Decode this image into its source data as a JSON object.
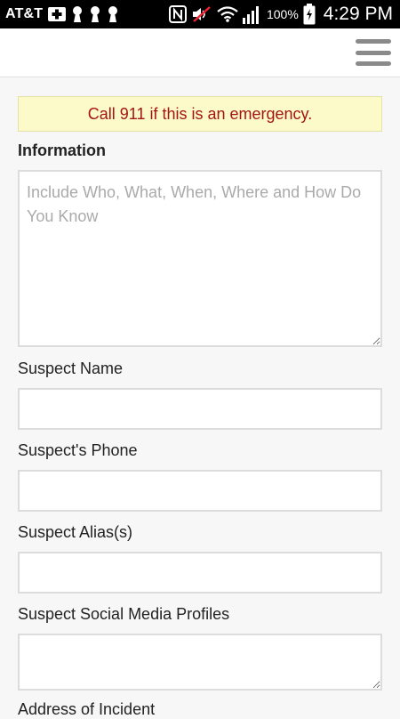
{
  "status_bar": {
    "carrier": "AT&T",
    "battery_percent": "100%",
    "time": "4:29 PM",
    "icons": [
      "medical-cross-icon",
      "keyhole-icon",
      "keyhole-icon",
      "keyhole-icon",
      "nfc-icon",
      "muted-speaker-icon",
      "wifi-icon",
      "signal-icon",
      "battery-charging-icon"
    ]
  },
  "header": {
    "menu_icon": "hamburger-menu-icon"
  },
  "form": {
    "alert_text": "Call 911 if this is an emergency.",
    "information_label": "Information",
    "information_placeholder": "Include Who, What, When, Where and How Do You Know",
    "suspect_name_label": "Suspect Name",
    "suspect_phone_label": "Suspect's Phone",
    "suspect_alias_label": "Suspect Alias(s)",
    "suspect_social_label": "Suspect Social Media Profiles",
    "address_label": "Address of Incident"
  },
  "colors": {
    "alert_background": "#fcfac8",
    "alert_text": "#a31515",
    "page_background": "#f7f7f7"
  }
}
